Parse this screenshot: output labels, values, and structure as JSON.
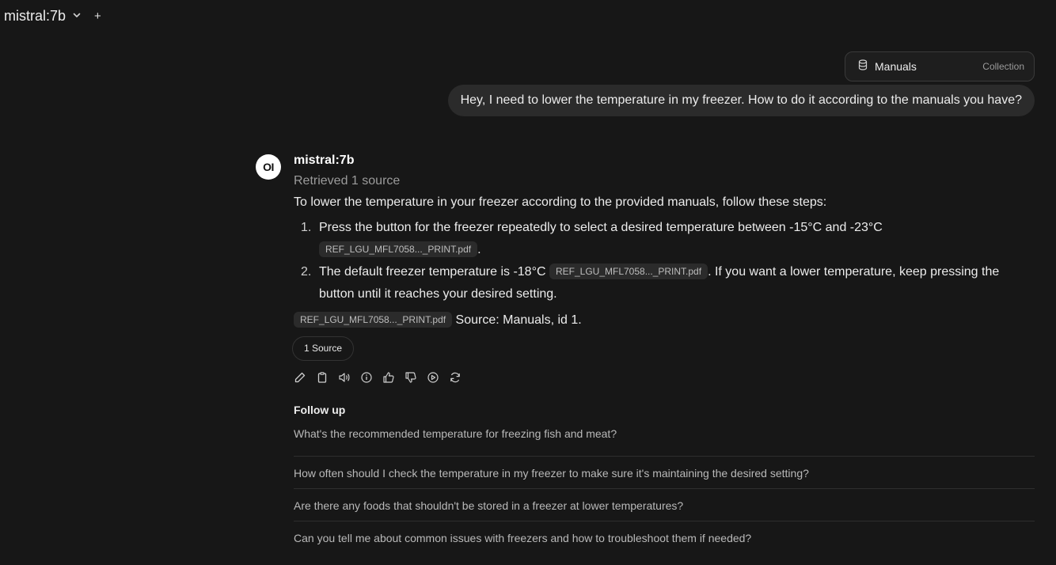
{
  "header": {
    "model_name": "mistral:7b",
    "new_chat": "+"
  },
  "collection": {
    "name": "Manuals",
    "kind": "Collection"
  },
  "user_message": "Hey, I need to lower the temperature in my freezer. How to do it according to the manuals you have?",
  "response": {
    "avatar_text": "OI",
    "model_name": "mistral:7b",
    "retrieved": "Retrieved 1 source",
    "intro": "To lower the temperature in your freezer according to the provided manuals, follow these steps:",
    "steps": [
      {
        "num": "1.",
        "text_a": "Press the button for the freezer repeatedly to select a desired temperature between -15°C and -23°C",
        "cite": "REF_LGU_MFL7058..._PRINT.pdf",
        "text_b": "."
      },
      {
        "num": "2.",
        "text_a": "The default freezer temperature is -18°C",
        "cite": "REF_LGU_MFL7058..._PRINT.pdf",
        "text_b": ". If you want a lower temperature, keep pressing the button until it reaches your desired setting."
      }
    ],
    "source_cite": "REF_LGU_MFL7058..._PRINT.pdf",
    "source_text": "Source: Manuals, id 1.",
    "sources_button": "1 Source"
  },
  "actions": [
    "edit-icon",
    "copy-icon",
    "read-aloud-icon",
    "info-icon",
    "thumbs-up-icon",
    "thumbs-down-icon",
    "continue-icon",
    "regenerate-icon"
  ],
  "followup": {
    "title": "Follow up",
    "items": [
      "What's the recommended temperature for freezing fish and meat?",
      "How often should I check the temperature in my freezer to make sure it's maintaining the desired setting?",
      "Are there any foods that shouldn't be stored in a freezer at lower temperatures?",
      "Can you tell me about common issues with freezers and how to troubleshoot them if needed?"
    ]
  }
}
